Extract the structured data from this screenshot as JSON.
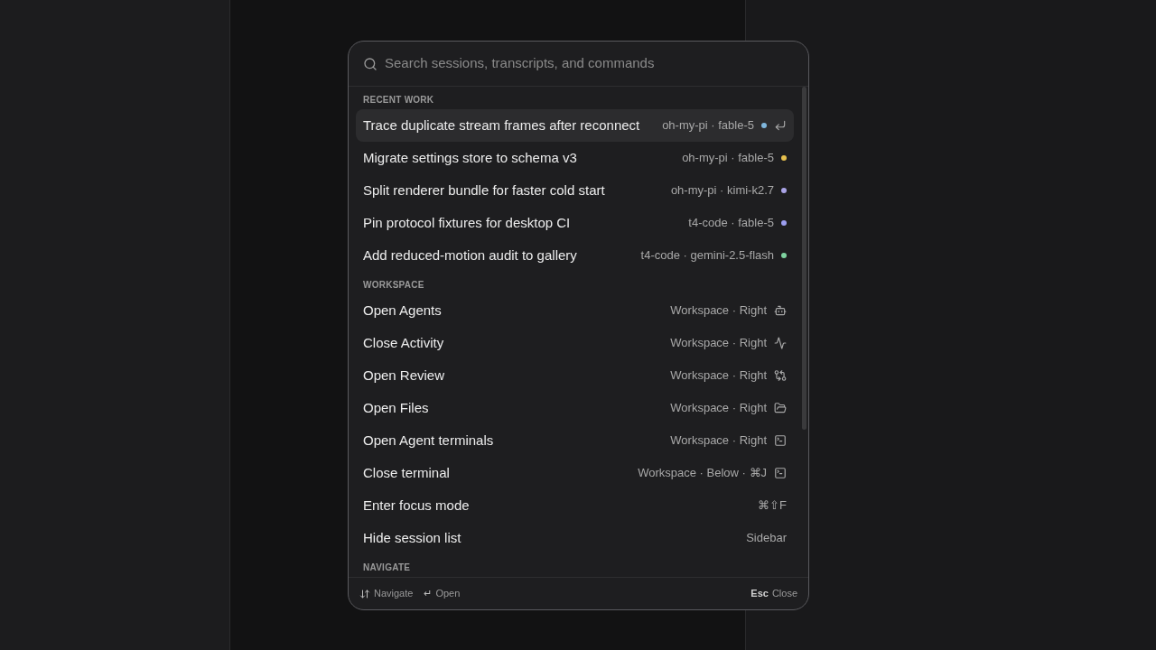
{
  "search": {
    "placeholder": "Search sessions, transcripts, and commands"
  },
  "sections": [
    {
      "title": "RECENT WORK",
      "items": [
        {
          "kind": "session",
          "label": "Trace duplicate stream frames after reconnect",
          "meta": "oh-my-pi · fable-5",
          "color": "#7fb6dc",
          "selected": true
        },
        {
          "kind": "session",
          "label": "Migrate settings store to schema v3",
          "meta": "oh-my-pi · fable-5",
          "color": "#e6c04e",
          "selected": false
        },
        {
          "kind": "session",
          "label": "Split renderer bundle for faster cold start",
          "meta": "oh-my-pi · kimi-k2.7",
          "color": "#aaa4e6",
          "selected": false
        },
        {
          "kind": "session",
          "label": "Pin protocol fixtures for desktop CI",
          "meta": "t4-code · fable-5",
          "color": "#9d9ff0",
          "selected": false
        },
        {
          "kind": "session",
          "label": "Add reduced-motion audit to gallery",
          "meta": "t4-code · gemini-2.5-flash",
          "color": "#7fd3a0",
          "selected": false
        }
      ]
    },
    {
      "title": "WORKSPACE",
      "items": [
        {
          "kind": "command",
          "label": "Open Agents",
          "meta": "Workspace · Right",
          "selected": false
        },
        {
          "kind": "command",
          "label": "Close Activity",
          "meta": "Workspace · Right",
          "selected": false
        },
        {
          "kind": "command",
          "label": "Open Review",
          "meta": "Workspace · Right",
          "selected": false
        },
        {
          "kind": "command",
          "label": "Open Files",
          "meta": "Workspace · Right",
          "selected": false
        },
        {
          "kind": "command",
          "label": "Open Agent terminals",
          "meta": "Workspace · Right",
          "selected": false
        },
        {
          "kind": "command",
          "label": "Close terminal",
          "meta": "Workspace · Below · ⌘J",
          "selected": false
        },
        {
          "kind": "command",
          "label": "Enter focus mode",
          "meta": "⌘⇧F",
          "selected": false
        },
        {
          "kind": "command",
          "label": "Hide session list",
          "meta": "Sidebar",
          "selected": false
        }
      ]
    },
    {
      "title": "NAVIGATE"
    }
  ],
  "footer": {
    "hints": [
      {
        "kind": "arrows",
        "label": "Navigate"
      },
      {
        "kind": "key",
        "key": "↵",
        "label": "Open"
      }
    ],
    "close": {
      "key": "Esc",
      "label": "Close"
    }
  }
}
